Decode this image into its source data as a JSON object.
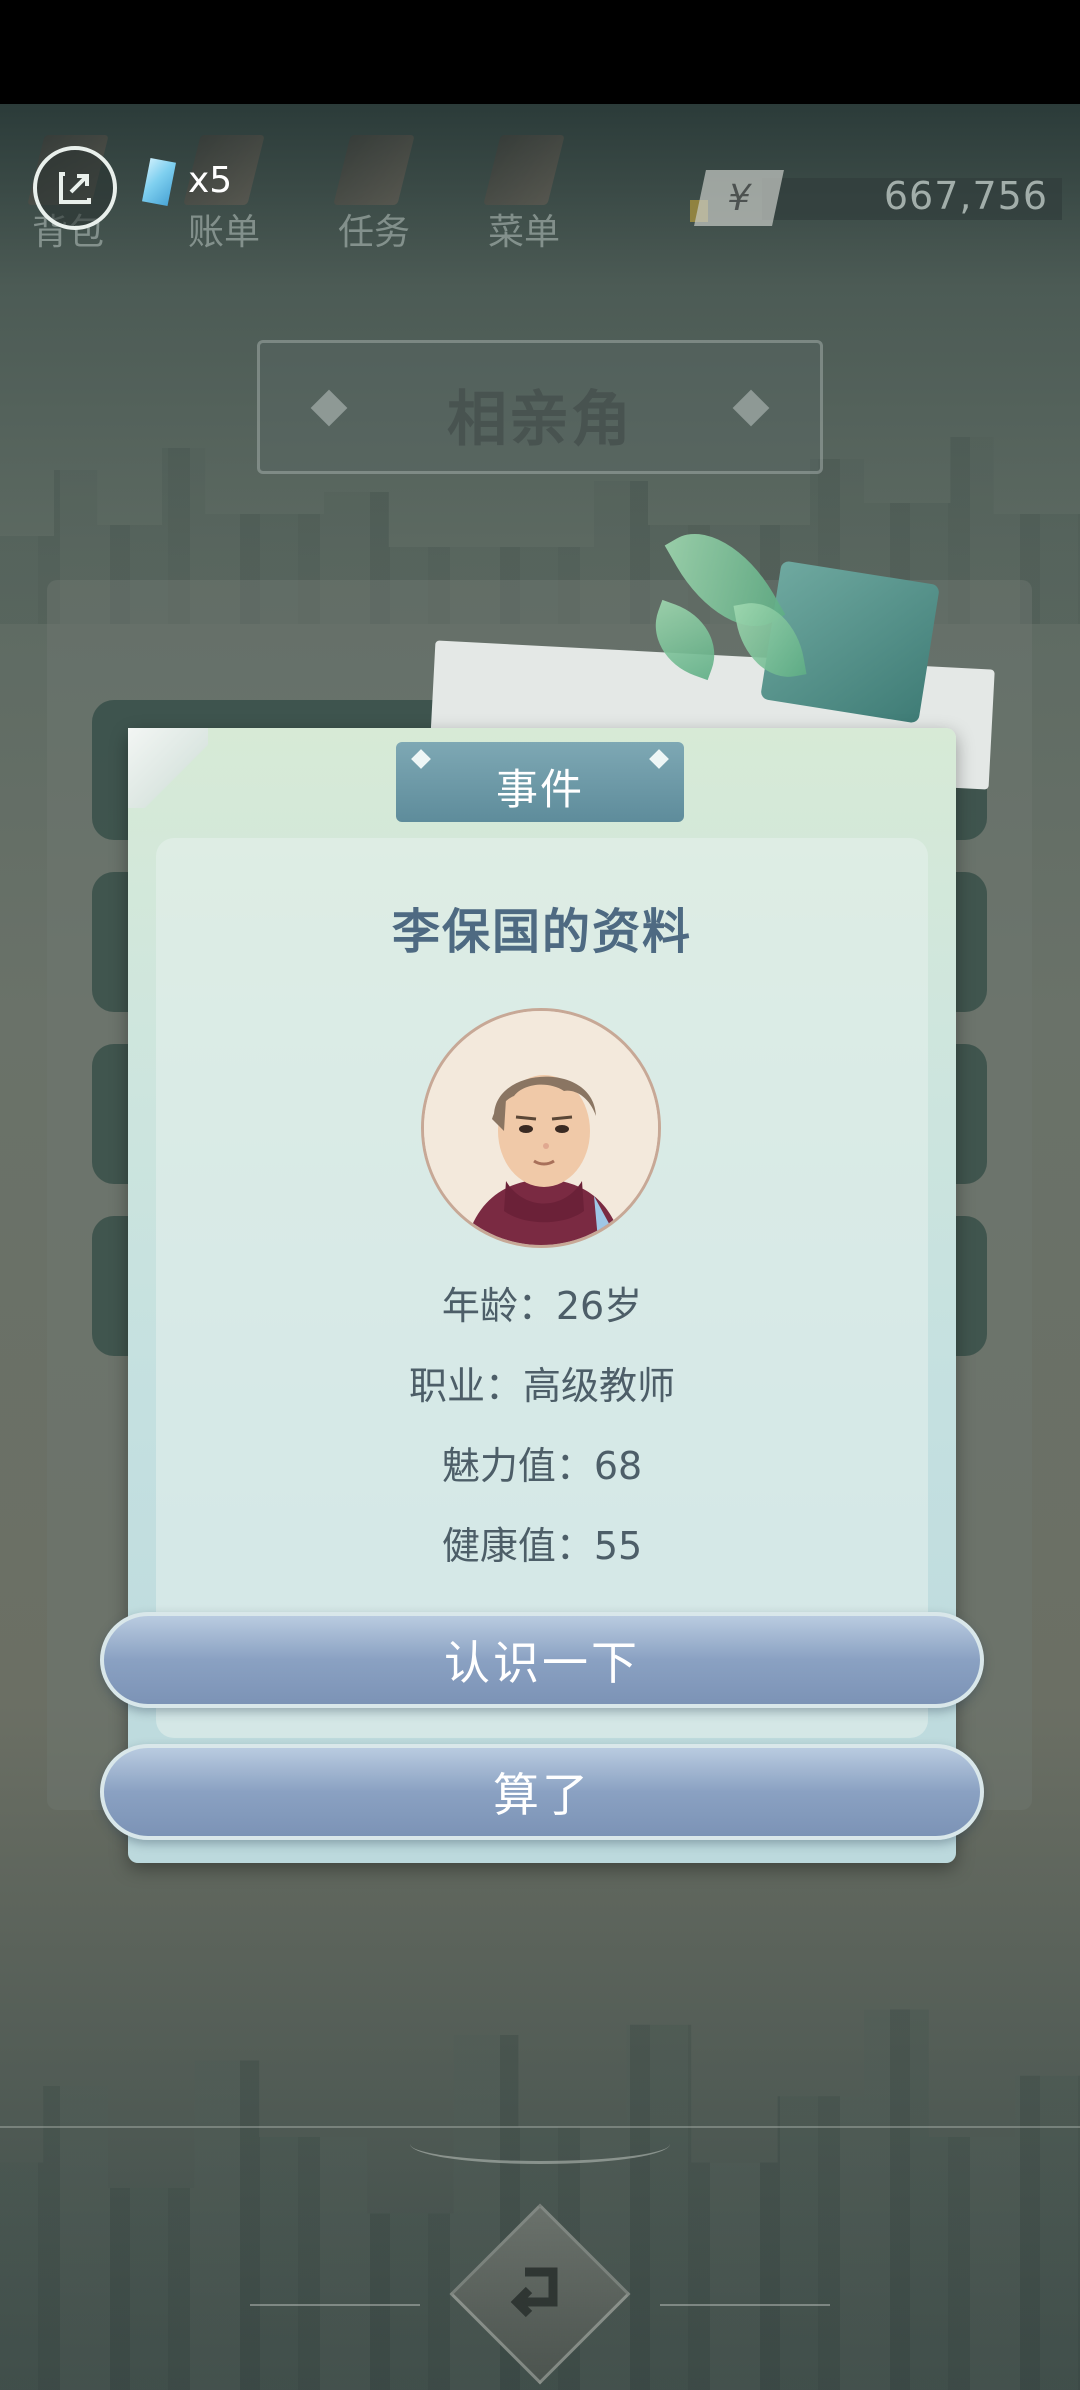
{
  "topbar": {
    "tabs": [
      {
        "label": "背包",
        "icon": "backpack-icon"
      },
      {
        "label": "账单",
        "icon": "bill-icon"
      },
      {
        "label": "任务",
        "icon": "task-icon"
      },
      {
        "label": "菜单",
        "icon": "menu-icon"
      }
    ],
    "gem_count": "x5",
    "currency_symbol": "¥",
    "money": "667,756"
  },
  "page": {
    "title": "相亲角"
  },
  "dialog": {
    "header": "事件",
    "profile_title": "李保国的资料",
    "avatar_icon": "avatar-portrait-icon",
    "stats": {
      "age": "年龄：26岁",
      "job": "职业：高级教师",
      "charm": "魅力值：68",
      "health": "健康值：55"
    },
    "buttons": {
      "meet": "认识一下",
      "decline": "算了"
    }
  },
  "colors": {
    "dialog_bg": "#cfe6dd",
    "title_text": "#4e6a82",
    "button_bg": "#8aa1c2"
  }
}
